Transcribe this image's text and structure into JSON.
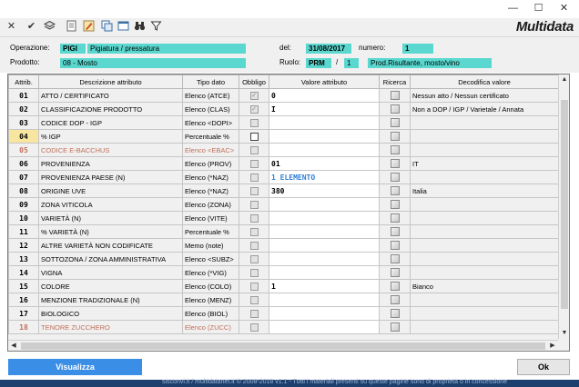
{
  "window": {
    "minimize_glyph": "—",
    "maximize_glyph": "☐",
    "close_glyph": "✕"
  },
  "toolbar": {
    "icons": [
      "close-x-icon",
      "check-icon",
      "stack-icon",
      "document-icon",
      "edit-icon",
      "copy-icon",
      "window-icon",
      "binoculars-icon",
      "filter-icon"
    ],
    "logo": "Multidata"
  },
  "header": {
    "operazione_label": "Operazione:",
    "operazione_code": "PIGI",
    "operazione_desc": "Pigiatura / pressatura",
    "del_label": "del:",
    "del_value": "31/08/2017",
    "numero_label": "numero:",
    "numero_value": "1",
    "prodotto_label": "Prodotto:",
    "prodotto_value": "08 - Mosto",
    "ruolo_label": "Ruolo:",
    "ruolo_code": "PRM",
    "ruolo_sep": "/",
    "ruolo_num": "1",
    "ruolo_desc": "Prod.Risultante, mosto/vino"
  },
  "grid": {
    "columns": [
      "Attrib.",
      "Descrizione attributo",
      "Tipo dato",
      "Obbligo",
      "Valore attributo",
      "Ricerca",
      "Decodifica valore"
    ],
    "rows": [
      {
        "code": "01",
        "desc": "ATTO / CERTIFICATO",
        "tipo": "Elenco (ATCE)",
        "obbligo": true,
        "valore": "0",
        "decodifica": "Nessun atto / Nessun certificato",
        "state": "normal"
      },
      {
        "code": "02",
        "desc": "CLASSIFICAZIONE PRODOTTO",
        "tipo": "Elenco (CLAS)",
        "obbligo": true,
        "valore": "I",
        "decodifica": "Non a DOP / IGP / Varietale / Annata",
        "state": "normal"
      },
      {
        "code": "03",
        "desc": "CODICE DOP - IGP",
        "tipo": "Elenco <DOPI>",
        "obbligo": false,
        "valore": "",
        "decodifica": "",
        "state": "normal"
      },
      {
        "code": "04",
        "desc": "% IGP",
        "tipo": "Percentuale %",
        "obbligo": false,
        "valore": "",
        "decodifica": "",
        "state": "selected"
      },
      {
        "code": "05",
        "desc": "CODICE E-BACCHUS",
        "tipo": "Elenco <EBAC>",
        "obbligo": false,
        "valore": "",
        "decodifica": "",
        "state": "disabled"
      },
      {
        "code": "06",
        "desc": "PROVENIENZA",
        "tipo": "Elenco (PROV)",
        "obbligo": false,
        "valore": "01",
        "decodifica": "IT",
        "state": "normal"
      },
      {
        "code": "07",
        "desc": "PROVENIENZA PAESE (N)",
        "tipo": "Elenco (*NAZ)",
        "obbligo": false,
        "valore": "1 ELEMENTO",
        "decodifica": "",
        "state": "normal",
        "blue": true
      },
      {
        "code": "08",
        "desc": "ORIGINE UVE",
        "tipo": "Elenco (*NAZ)",
        "obbligo": false,
        "valore": "380",
        "decodifica": "Italia",
        "state": "normal"
      },
      {
        "code": "09",
        "desc": "ZONA VITICOLA",
        "tipo": "Elenco (ZONA)",
        "obbligo": false,
        "valore": "",
        "decodifica": "",
        "state": "normal"
      },
      {
        "code": "10",
        "desc": "VARIETÀ (N)",
        "tipo": "Elenco (VITE)",
        "obbligo": false,
        "valore": "",
        "decodifica": "",
        "state": "normal"
      },
      {
        "code": "11",
        "desc": "% VARIETÀ (N)",
        "tipo": "Percentuale %",
        "obbligo": false,
        "valore": "",
        "decodifica": "",
        "state": "normal"
      },
      {
        "code": "12",
        "desc": "ALTRE VARIETÀ NON CODIFICATE",
        "tipo": "Memo (note)",
        "obbligo": false,
        "valore": "",
        "decodifica": "",
        "state": "normal"
      },
      {
        "code": "13",
        "desc": "SOTTOZONA / ZONA AMMINISTRATIVA",
        "tipo": "Elenco <SUBZ>",
        "obbligo": false,
        "valore": "",
        "decodifica": "",
        "state": "normal"
      },
      {
        "code": "14",
        "desc": "VIGNA",
        "tipo": "Elenco (*VIG)",
        "obbligo": false,
        "valore": "",
        "decodifica": "",
        "state": "normal"
      },
      {
        "code": "15",
        "desc": "COLORE",
        "tipo": "Elenco (COLO)",
        "obbligo": false,
        "valore": "1",
        "decodifica": "Bianco",
        "state": "normal"
      },
      {
        "code": "16",
        "desc": "MENZIONE TRADIZIONALE (N)",
        "tipo": "Elenco (MENZ)",
        "obbligo": false,
        "valore": "",
        "decodifica": "",
        "state": "normal"
      },
      {
        "code": "17",
        "desc": "BIOLOGICO",
        "tipo": "Elenco (BIOL)",
        "obbligo": false,
        "valore": "",
        "decodifica": "",
        "state": "normal"
      },
      {
        "code": "18",
        "desc": "TENORE ZUCCHERO",
        "tipo": "Elenco (ZUCC)",
        "obbligo": false,
        "valore": "",
        "decodifica": "",
        "state": "disabled"
      }
    ]
  },
  "buttons": {
    "visualizza": "Visualizza",
    "ok": "Ok"
  },
  "footer": {
    "text": "sisconvi.it / multidatanet.it © 2008-2018 v1.1 - Tutti i materiali presenti su queste pagine sono di proprietà o in concessione"
  },
  "colors": {
    "field_bg": "#5ad8d0",
    "selected_code_bg": "#f8e6a0",
    "disabled_text": "#c0705a",
    "link_blue": "#2f7fd6",
    "button_blue": "#3a8ee6"
  }
}
